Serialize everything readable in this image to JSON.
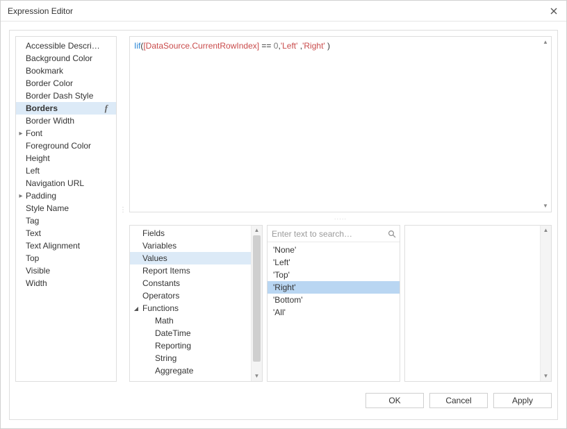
{
  "window": {
    "title": "Expression Editor"
  },
  "expression": {
    "func": "Iif",
    "bracketed": "[DataSource.CurrentRowIndex]",
    "afterBracket": " == ",
    "num": "0",
    "comma1": ",",
    "str1": "'Left'",
    "comma2": " ,",
    "str2": "'Right'",
    "close": " )"
  },
  "properties": [
    {
      "label": "Accessible Descri…",
      "selected": false,
      "expandable": false
    },
    {
      "label": "Background Color",
      "selected": false,
      "expandable": false
    },
    {
      "label": "Bookmark",
      "selected": false,
      "expandable": false
    },
    {
      "label": "Border Color",
      "selected": false,
      "expandable": false
    },
    {
      "label": "Border Dash Style",
      "selected": false,
      "expandable": false
    },
    {
      "label": "Borders",
      "selected": true,
      "fx": true,
      "expandable": false
    },
    {
      "label": "Border Width",
      "selected": false,
      "expandable": false
    },
    {
      "label": "Font",
      "selected": false,
      "expandable": true
    },
    {
      "label": "Foreground Color",
      "selected": false,
      "expandable": false
    },
    {
      "label": "Height",
      "selected": false,
      "expandable": false
    },
    {
      "label": "Left",
      "selected": false,
      "expandable": false
    },
    {
      "label": "Navigation URL",
      "selected": false,
      "expandable": false
    },
    {
      "label": "Padding",
      "selected": false,
      "expandable": true
    },
    {
      "label": "Style Name",
      "selected": false,
      "expandable": false
    },
    {
      "label": "Tag",
      "selected": false,
      "expandable": false
    },
    {
      "label": "Text",
      "selected": false,
      "expandable": false
    },
    {
      "label": "Text Alignment",
      "selected": false,
      "expandable": false
    },
    {
      "label": "Top",
      "selected": false,
      "expandable": false
    },
    {
      "label": "Visible",
      "selected": false,
      "expandable": false
    },
    {
      "label": "Width",
      "selected": false,
      "expandable": false
    }
  ],
  "categories": [
    {
      "label": "Fields",
      "level": 0
    },
    {
      "label": "Variables",
      "level": 0
    },
    {
      "label": "Values",
      "level": 0,
      "selected": true
    },
    {
      "label": "Report Items",
      "level": 0
    },
    {
      "label": "Constants",
      "level": 0
    },
    {
      "label": "Operators",
      "level": 0
    },
    {
      "label": "Functions",
      "level": 0,
      "expanded": true
    },
    {
      "label": "Math",
      "level": 1
    },
    {
      "label": "DateTime",
      "level": 1
    },
    {
      "label": "Reporting",
      "level": 1
    },
    {
      "label": "String",
      "level": 1
    },
    {
      "label": "Aggregate",
      "level": 1
    }
  ],
  "search": {
    "placeholder": "Enter text to search…"
  },
  "values": [
    {
      "label": "'None'"
    },
    {
      "label": "'Left'"
    },
    {
      "label": "'Top'"
    },
    {
      "label": "'Right'",
      "selected": true
    },
    {
      "label": "'Bottom'"
    },
    {
      "label": "'All'"
    }
  ],
  "buttons": {
    "ok": "OK",
    "cancel": "Cancel",
    "apply": "Apply"
  }
}
